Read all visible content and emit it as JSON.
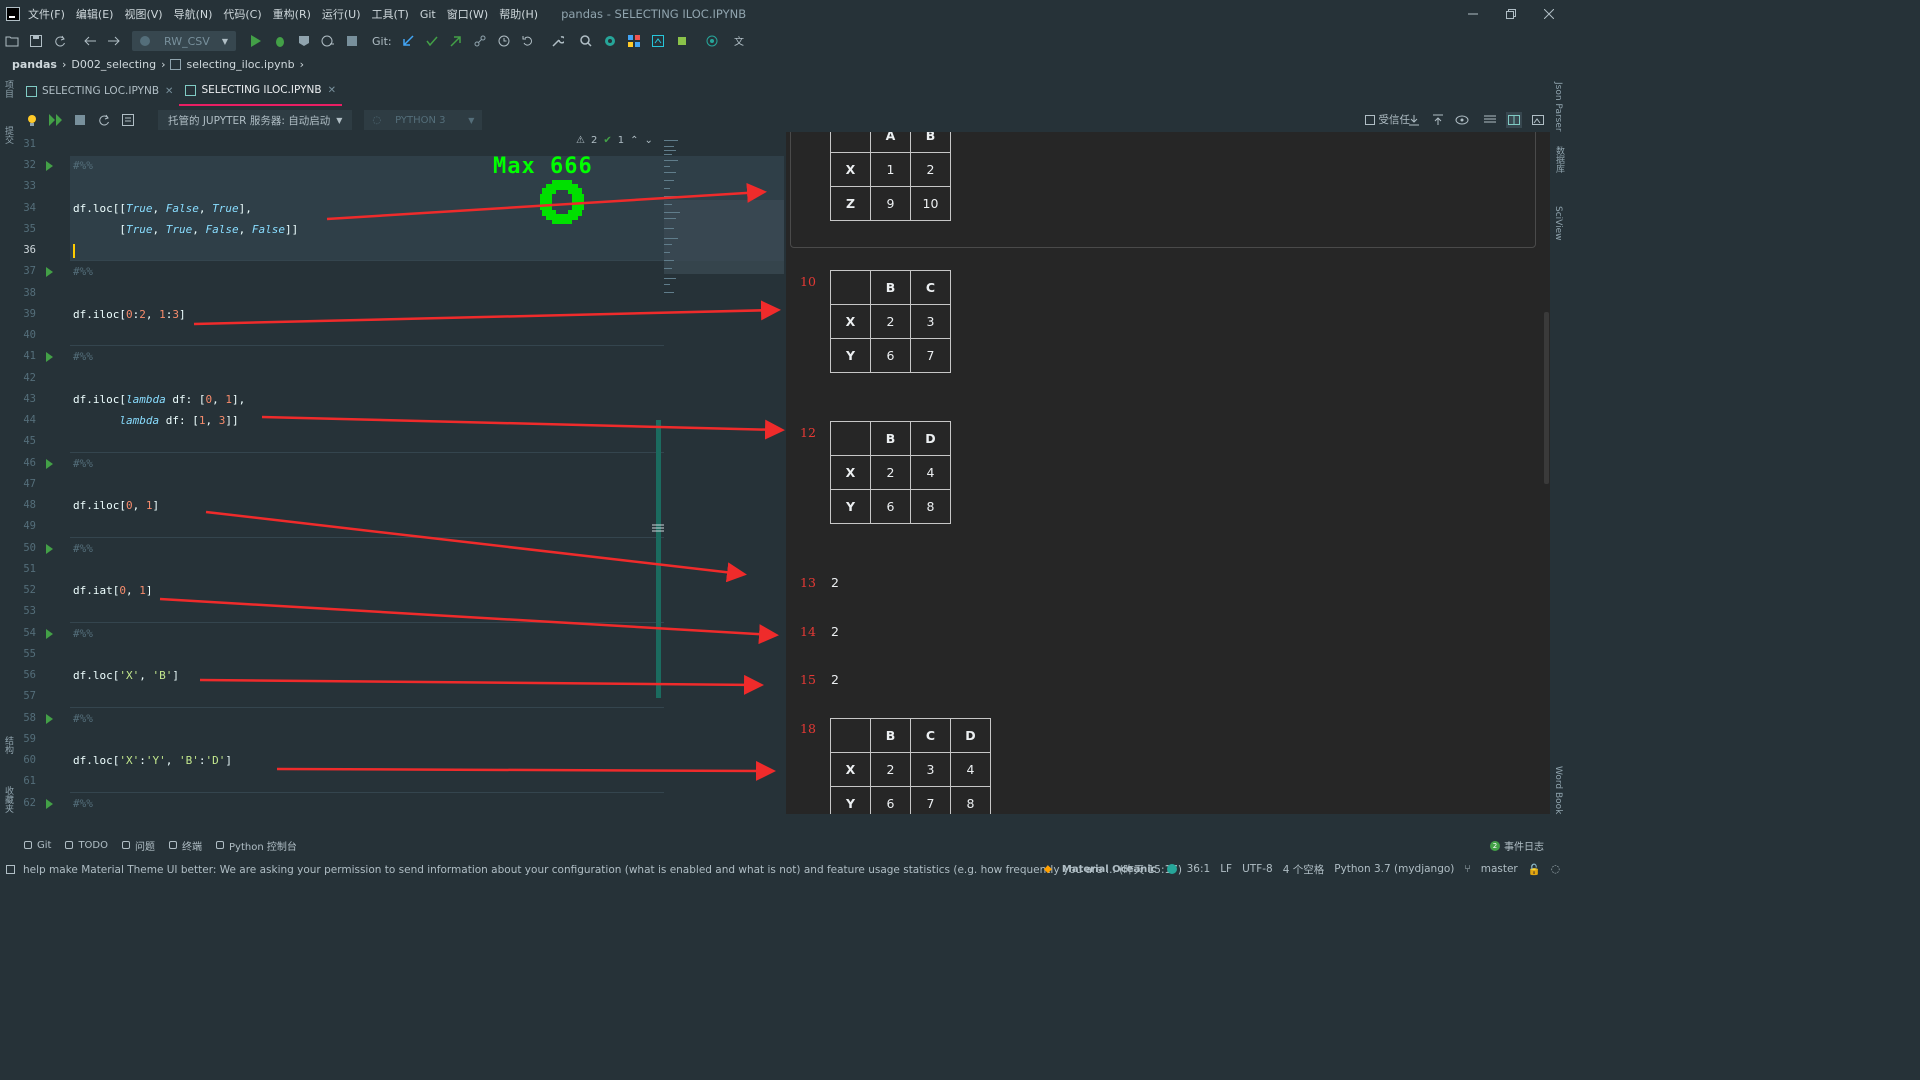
{
  "menu": {
    "items": [
      "文件(F)",
      "编辑(E)",
      "视图(V)",
      "导航(N)",
      "代码(C)",
      "重构(R)",
      "运行(U)",
      "工具(T)",
      "Git",
      "窗口(W)",
      "帮助(H)"
    ],
    "window_title": "pandas - SELECTING ILOC.IPYNB"
  },
  "toolbar": {
    "run_config": "RW_CSV",
    "git_label": "Git:"
  },
  "breadcrumb": {
    "project": "pandas",
    "folder": "D002_selecting",
    "file": "selecting_iloc.ipynb"
  },
  "left_strip": {
    "top_label": "项目",
    "commit_label": "提交",
    "structure_label": "结构",
    "favorites_label": "收藏夹"
  },
  "right_strip": {
    "json_parser": "Json Parser",
    "database": "数据库",
    "sciview": "SciView",
    "word_book": "Word Book"
  },
  "tabs": [
    {
      "label": "SELECTING LOC.IPYNB",
      "active": false
    },
    {
      "label": "SELECTING ILOC.IPYNB",
      "active": true
    }
  ],
  "notebook_toolbar": {
    "server": "托管的 JUPYTER 服务器: 自动启动",
    "kernel": "PYTHON 3",
    "trusted_label": "受信任"
  },
  "inspection": {
    "warnings": "2",
    "ok": "1"
  },
  "game": {
    "title": "Max 666"
  },
  "editor": {
    "line_numbers": [
      "31",
      "32",
      "33",
      "34",
      "35",
      "36",
      "37",
      "38",
      "39",
      "40",
      "41",
      "42",
      "43",
      "44",
      "45",
      "46",
      "47",
      "48",
      "49",
      "50",
      "51",
      "52",
      "53",
      "54",
      "55",
      "56",
      "57",
      "58",
      "59",
      "60",
      "61",
      "62"
    ],
    "current_line": "36",
    "cell_marker": "#%%",
    "code": {
      "l34_a": "df.loc[[",
      "l34_t1": "True",
      "l34_c1": ", ",
      "l34_f1": "False",
      "l34_c2": ", ",
      "l34_t2": "True",
      "l34_end": "],",
      "l35_a": "       [",
      "l35_t1": "True",
      "l35_c1": ", ",
      "l35_t2": "True",
      "l35_c2": ", ",
      "l35_f1": "False",
      "l35_c3": ", ",
      "l35_f2": "False",
      "l35_end": "]]",
      "l39_a": "df.iloc[",
      "l39_n1": "0",
      "l39_b": ":",
      "l39_n2": "2",
      "l39_c": ", ",
      "l39_n3": "1",
      "l39_d": ":",
      "l39_n4": "3",
      "l39_e": "]",
      "l43_a": "df.iloc[",
      "l43_kw": "lambda",
      "l43_b": " df: [",
      "l43_n1": "0",
      "l43_c": ", ",
      "l43_n2": "1",
      "l43_e": "],",
      "l44_a": "       ",
      "l44_kw": "lambda",
      "l44_b": " df: [",
      "l44_n1": "1",
      "l44_c": ", ",
      "l44_n2": "3",
      "l44_e": "]]",
      "l48_a": "df.iloc[",
      "l48_n1": "0",
      "l48_c": ", ",
      "l48_n2": "1",
      "l48_e": "]",
      "l52_a": "df.iat[",
      "l52_n1": "0",
      "l52_c": ", ",
      "l52_n2": "1",
      "l52_e": "]",
      "l56_a": "df.loc[",
      "l56_s1": "'X'",
      "l56_c": ", ",
      "l56_s2": "'B'",
      "l56_e": "]",
      "l60_a": "df.loc[",
      "l60_s1": "'X'",
      "l60_b": ":",
      "l60_s2": "'Y'",
      "l60_c": ", ",
      "l60_s3": "'B'",
      "l60_d": ":",
      "l60_s4": "'D'",
      "l60_e": "]"
    }
  },
  "outputs": {
    "o1": {
      "header": [
        "",
        "A",
        "B"
      ],
      "rows": [
        [
          "X",
          "1",
          "2"
        ],
        [
          "Z",
          "9",
          "10"
        ]
      ]
    },
    "o10": {
      "index": "10",
      "header": [
        "",
        "B",
        "C"
      ],
      "rows": [
        [
          "X",
          "2",
          "3"
        ],
        [
          "Y",
          "6",
          "7"
        ]
      ]
    },
    "o12": {
      "index": "12",
      "header": [
        "",
        "B",
        "D"
      ],
      "rows": [
        [
          "X",
          "2",
          "4"
        ],
        [
          "Y",
          "6",
          "8"
        ]
      ]
    },
    "o13": {
      "index": "13",
      "value": "2"
    },
    "o14": {
      "index": "14",
      "value": "2"
    },
    "o15": {
      "index": "15",
      "value": "2"
    },
    "o18": {
      "index": "18",
      "header": [
        "",
        "B",
        "C",
        "D"
      ],
      "rows": [
        [
          "X",
          "2",
          "3",
          "4"
        ],
        [
          "Y",
          "6",
          "7",
          "8"
        ]
      ]
    }
  },
  "bottom_tools": {
    "git": "Git",
    "todo": "TODO",
    "problems": "问题",
    "terminal": "终端",
    "python_console": "Python 控制台",
    "event_log": "事件日志",
    "event_count": "2"
  },
  "status": {
    "message": "help make Material Theme UI better: We are asking your permission to send information about your configuration (what is enabled and what is not) and feature usage statistics (e.g. how frequently you are ... (昨天 15:17)",
    "theme": "Material Oceanic",
    "position": "36:1",
    "line_ending": "LF",
    "encoding": "UTF-8",
    "indent": "4 个空格",
    "interpreter": "Python 3.7 (mydjango)",
    "branch": "master"
  },
  "colors": {
    "background": "#263238",
    "output_background": "#262626",
    "accent": "#e91e63",
    "arrow": "#ef2b2b",
    "game_green": "#00ff00"
  }
}
